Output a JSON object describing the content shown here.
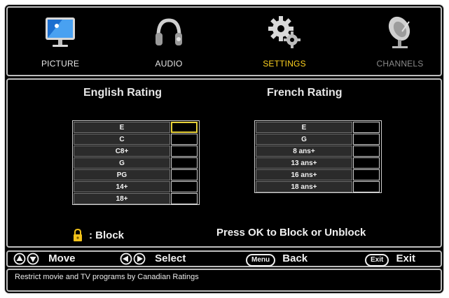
{
  "menu": {
    "items": [
      {
        "label": "PICTURE",
        "icon": "monitor-icon"
      },
      {
        "label": "AUDIO",
        "icon": "headphones-icon"
      },
      {
        "label": "SETTINGS",
        "icon": "gears-icon",
        "selected": true
      },
      {
        "label": "CHANNELS",
        "icon": "satellite-dish-icon"
      }
    ]
  },
  "english": {
    "title": "English Rating",
    "ratings": [
      "E",
      "C",
      "C8+",
      "G",
      "PG",
      "14+",
      "18+"
    ]
  },
  "french": {
    "title": "French Rating",
    "ratings": [
      "E",
      "G",
      "8 ans+",
      "13 ans+",
      "16 ans+",
      "18 ans+"
    ]
  },
  "legend": {
    "lock_label": ": Block",
    "hint": "Press OK to Block or Unblock"
  },
  "help": {
    "move": "Move",
    "select": "Select",
    "back_key": "Menu",
    "back": "Back",
    "exit_key": "Exit",
    "exit": "Exit"
  },
  "status": "Restrict movie and TV programs by Canadian Ratings",
  "colors": {
    "accent": "#ffd21f",
    "background": "#000000",
    "border": "#bdbdbd"
  }
}
